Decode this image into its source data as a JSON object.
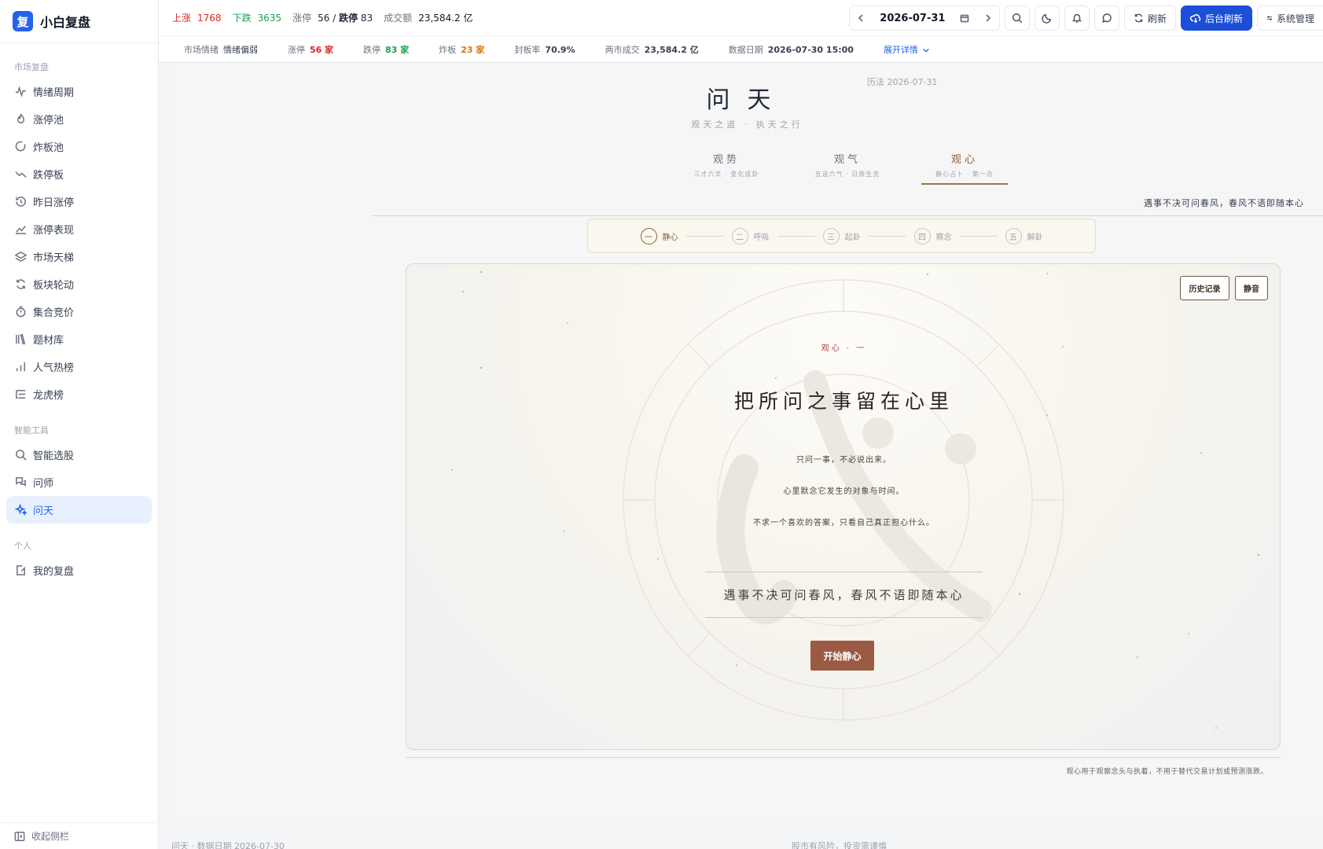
{
  "brand": {
    "logo_char": "复",
    "name": "小白复盘"
  },
  "sidebar": {
    "groups": [
      {
        "title": "市场复盘",
        "items": [
          "情绪周期",
          "涨停池",
          "炸板池",
          "跌停板",
          "昨日涨停",
          "涨停表现",
          "市场天梯",
          "板块轮动",
          "集合竞价",
          "题材库",
          "人气热榜",
          "龙虎榜"
        ]
      },
      {
        "title": "智能工具",
        "items": [
          "智能选股",
          "问师",
          "问天"
        ]
      },
      {
        "title": "个人",
        "items": [
          "我的复盘"
        ]
      }
    ],
    "active_item": "问天",
    "collapse_label": "收起侧栏"
  },
  "topbar": {
    "up_label": "上涨",
    "up_value": "1768",
    "down_label": "下跌",
    "down_value": "3635",
    "limit_label": "涨停",
    "limit_value": "56 / ",
    "limitdown_label": "跌停",
    "limitdown_value": " 83",
    "turnover_label": "成交额",
    "turnover_value": "23,584.2 亿",
    "date": "2026-07-31",
    "refresh_label": "刷新",
    "bg_refresh_label": "后台刷新",
    "system_label": "系统管理"
  },
  "subbar": {
    "sentiment_label": "市场情绪",
    "sentiment_value": "情绪偏弱",
    "limitup_label": "涨停",
    "limitup_value": "56 家",
    "limitdown_label": "跌停",
    "limitdown_value": "83 家",
    "broken_label": "炸板",
    "broken_value": "23 家",
    "seal_label": "封板率",
    "seal_value": "70.9%",
    "volume_label": "两市成交",
    "volume_value": "23,584.2 亿",
    "datadate_label": "数据日期",
    "datadate_value": "2026-07-30 15:00",
    "expand_label": "展开详情"
  },
  "page": {
    "title": "问天",
    "calendar_date": "历法 2026-07-31",
    "subtitle": "观天之道 · 执天之行",
    "tabs": [
      {
        "title": "观势",
        "sub": "三才六爻 · 变化成卦"
      },
      {
        "title": "观气",
        "sub": "五运六气 · 日辰生克"
      },
      {
        "title": "观心",
        "sub": "静心占卜 · 第一念"
      }
    ],
    "right_quote": "遇事不决可问春风，春风不语即随本心",
    "steps": [
      {
        "num": "一",
        "label": "静心"
      },
      {
        "num": "二",
        "label": "呼吸"
      },
      {
        "num": "三",
        "label": "起卦"
      },
      {
        "num": "四",
        "label": "察念"
      },
      {
        "num": "五",
        "label": "解卦"
      }
    ],
    "card": {
      "history_label": "历史记录",
      "mute_label": "静音",
      "kicker": "观心 · 一",
      "title": "把所问之事留在心里",
      "lines": [
        "只问一事，不必说出来。",
        "心里默念它发生的对象与时间。",
        "不求一个喜欢的答案，只看自己真正担心什么。"
      ],
      "quote": "遇事不决可问春风，春风不语即随本心",
      "start_label": "开始静心"
    },
    "disclaimer": "观心用于观察念头与执着，不用于替代交易计划或预测涨跌。"
  },
  "footer": {
    "left": "问天 · 数据日期 2026-07-30",
    "center": "股市有风险，投资需谨慎"
  },
  "colors": {
    "accent": "#2563eb",
    "up": "#dc2626",
    "down": "#16a34a",
    "warm": "#9a5a44"
  }
}
